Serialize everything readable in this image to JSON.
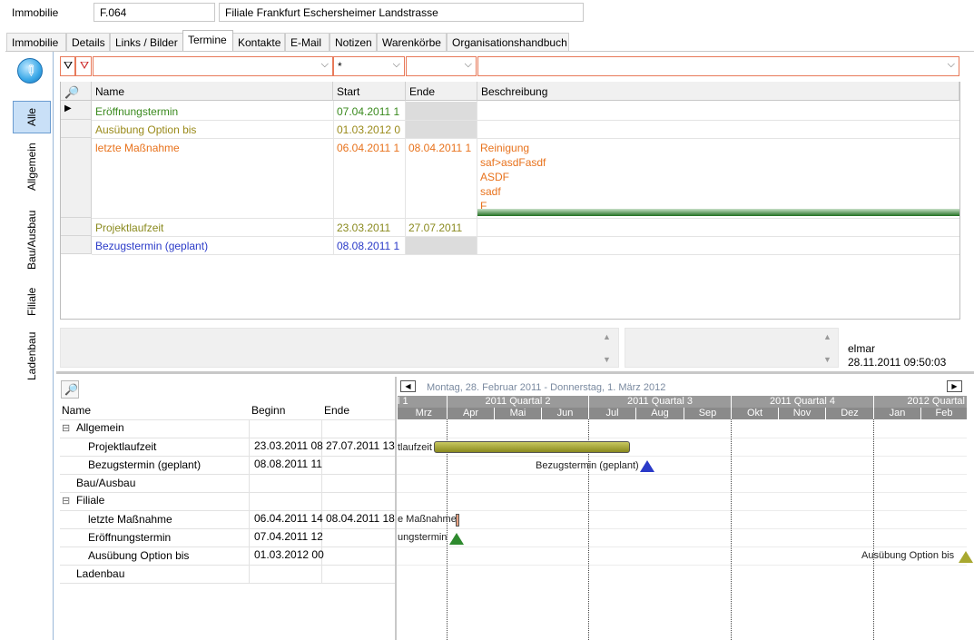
{
  "header": {
    "label": "Immobilie",
    "code": "F.064",
    "name": "Filiale Frankfurt Eschersheimer Landstrasse"
  },
  "tabs": [
    {
      "label": "Immobilie"
    },
    {
      "label": "Details"
    },
    {
      "label": "Links / Bilder"
    },
    {
      "label": "Termine"
    },
    {
      "label": "Kontakte"
    },
    {
      "label": "E-Mail"
    },
    {
      "label": "Notizen"
    },
    {
      "label": "Warenkörbe"
    },
    {
      "label": "Organisationshandbuch"
    }
  ],
  "active_tab": "Termine",
  "side_tabs": [
    {
      "label": "Alle"
    },
    {
      "label": "Allgemein"
    },
    {
      "label": "Bau/Ausbau"
    },
    {
      "label": "Filiale"
    },
    {
      "label": "Ladenbau"
    }
  ],
  "filter": {
    "name": "",
    "start": "*",
    "end": "",
    "description": ""
  },
  "grid": {
    "columns": {
      "name": "Name",
      "start": "Start",
      "end": "Ende",
      "description": "Beschreibung"
    },
    "rows": [
      {
        "name": "Eröffnungstermin",
        "start": "07.04.2011 1",
        "end": "",
        "description": [],
        "color": "#3a8a1e"
      },
      {
        "name": "Ausübung Option bis",
        "start": "01.03.2012 0",
        "end": "",
        "description": [],
        "color": "#9a8a1a"
      },
      {
        "name": "letzte Maßnahme",
        "start": "06.04.2011 1",
        "end": "08.04.2011 1",
        "description": [
          "Reinigung",
          "saf>asdFasdf",
          "ASDF",
          "sadf",
          "F"
        ],
        "color": "#e8721c"
      },
      {
        "name": "Projektlaufzeit",
        "start": "23.03.2011",
        "end": "27.07.2011",
        "description": [],
        "color": "#8a8a1e"
      },
      {
        "name": "Bezugstermin (geplant)",
        "start": "08.08.2011 1",
        "end": "",
        "description": [],
        "color": "#2a3ac8"
      }
    ]
  },
  "info": {
    "user": "elmar",
    "timestamp": "28.11.2011 09:50:03"
  },
  "gantt": {
    "range_title": "Montag, 28. Februar 2011 - Donnerstag, 1. März 2012",
    "columns": {
      "name": "Name",
      "begin": "Beginn",
      "end": "Ende"
    },
    "quarters": [
      "l 1",
      "2011 Quartal 2",
      "2011 Quartal 3",
      "2011 Quartal 4",
      "2012 Quartal"
    ],
    "months": [
      "Mrz",
      "Apr",
      "Mai",
      "Jun",
      "Jul",
      "Aug",
      "Sep",
      "Okt",
      "Nov",
      "Dez",
      "Jan",
      "Feb"
    ],
    "tree": [
      {
        "type": "group",
        "label": "Allgemein",
        "expanded": true
      },
      {
        "type": "item",
        "label": "Projektlaufzeit",
        "begin": "23.03.2011 08",
        "end": "27.07.2011 13"
      },
      {
        "type": "item",
        "label": "Bezugstermin (geplant)",
        "begin": "08.08.2011 11",
        "end": ""
      },
      {
        "type": "group",
        "label": "Bau/Ausbau",
        "expanded": false
      },
      {
        "type": "group",
        "label": "Filiale",
        "expanded": true
      },
      {
        "type": "item",
        "label": "letzte Maßnahme",
        "begin": "06.04.2011 14",
        "end": "08.04.2011 18"
      },
      {
        "type": "item",
        "label": "Eröffnungstermin",
        "begin": "07.04.2011 12",
        "end": ""
      },
      {
        "type": "item",
        "label": "Ausübung Option bis",
        "begin": "01.03.2012 00",
        "end": ""
      },
      {
        "type": "group",
        "label": "Ladenbau",
        "expanded": false
      }
    ],
    "bar_labels": {
      "projektlaufzeit": "tlaufzeit",
      "bezugstermin": "Bezugstermin (geplant)",
      "massnahme": "e Maßnahme",
      "eroeffnung": "ungstermin",
      "option": "Ausübung Option bis"
    },
    "colors": {
      "bar": "#9a9a2a",
      "triangle_blue": "#2a3ac8",
      "triangle_green": "#2e8a2e",
      "triangle_olive": "#a8a830"
    }
  }
}
